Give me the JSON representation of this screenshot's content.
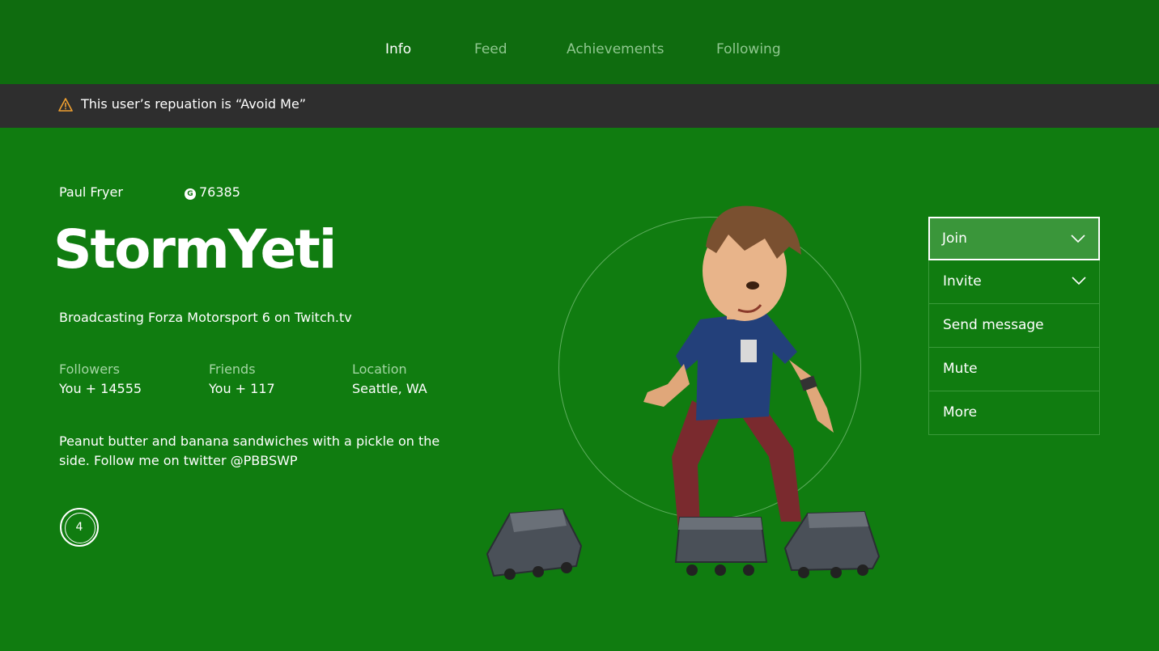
{
  "tabs": [
    {
      "label": "Info",
      "active": true
    },
    {
      "label": "Feed",
      "active": false
    },
    {
      "label": "Achievements",
      "active": false
    },
    {
      "label": "Following",
      "active": false
    }
  ],
  "warning": {
    "icon": "warning-triangle-icon",
    "text": "This user’s repuation is “Avoid Me”"
  },
  "profile": {
    "real_name": "Paul Fryer",
    "gamerscore_icon": "gamerscore-g-icon",
    "gamerscore": "76385",
    "gamertag": "StormYeti",
    "presence": "Broadcasting Forza Motorsport 6 on Twitch.tv",
    "stats": [
      {
        "label": "Followers",
        "value": "You + 14555"
      },
      {
        "label": "Friends",
        "value": "You + 117"
      },
      {
        "label": "Location",
        "value": "Seattle, WA"
      }
    ],
    "bio": "Peanut butter and banana sandwiches with a pickle on the side. Follow me on twitter @PBBSWP",
    "reputation_level": "4"
  },
  "actions": [
    {
      "label": "Join",
      "has_dropdown": true,
      "focused": true
    },
    {
      "label": "Invite",
      "has_dropdown": true,
      "focused": false
    },
    {
      "label": "Send message",
      "has_dropdown": false,
      "focused": false
    },
    {
      "label": "Mute",
      "has_dropdown": false,
      "focused": false
    },
    {
      "label": "More",
      "has_dropdown": false,
      "focused": false
    }
  ],
  "colors": {
    "background": "#107c10",
    "nav_background": "#0f6c0f",
    "warning_background": "#2e2e2e",
    "warning_icon": "#f0a030",
    "focused_button": "#3a963a"
  }
}
